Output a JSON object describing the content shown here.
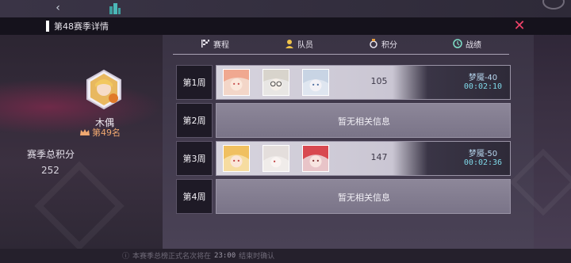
{
  "header": {
    "title": "第48赛季详情"
  },
  "player": {
    "name": "木偶",
    "rank": "第49名"
  },
  "season_total": {
    "label": "赛季总积分",
    "value": "252"
  },
  "tabs": [
    {
      "label": "赛程",
      "icon": "flag-icon"
    },
    {
      "label": "队员",
      "icon": "member-icon"
    },
    {
      "label": "积分",
      "icon": "medal-icon"
    },
    {
      "label": "战绩",
      "icon": "clock-icon"
    }
  ],
  "weeks": [
    {
      "label": "第1周",
      "score": "105",
      "difficulty": "梦魇-40",
      "time": "00:02:10",
      "empty": ""
    },
    {
      "label": "第2周",
      "score": "",
      "difficulty": "",
      "time": "",
      "empty": "暂无相关信息"
    },
    {
      "label": "第3周",
      "score": "147",
      "difficulty": "梦魇-50",
      "time": "00:02:36",
      "empty": ""
    },
    {
      "label": "第4周",
      "score": "",
      "difficulty": "",
      "time": "",
      "empty": "暂无相关信息"
    }
  ],
  "footer": {
    "prefix": "本赛季总榜正式名次将在",
    "time": "23:00",
    "suffix": "结束时确认"
  },
  "colors": {
    "accent_red": "#f0436a",
    "time_cyan": "#7fd8e8",
    "rank_orange": "#f0a870"
  }
}
